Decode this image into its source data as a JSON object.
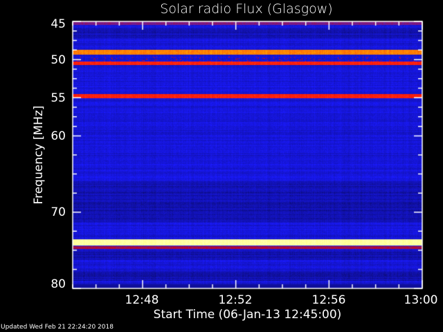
{
  "chart_data": {
    "type": "heatmap",
    "title": "Solar radio Flux (Glasgow)",
    "xlabel": "Start Time (06-Jan-13 12:45:00)",
    "ylabel": "Frequency [MHz]",
    "x_range": [
      "12:45",
      "13:00"
    ],
    "y_range": [
      45,
      80
    ],
    "y_inverted": true,
    "x_ticks": [
      "12:48",
      "12:52",
      "12:56",
      "13:00"
    ],
    "y_ticks": [
      "45",
      "50",
      "55",
      "60",
      "70",
      "80"
    ],
    "colormap": [
      "#000000",
      "#1010a0",
      "#1a1aff",
      "#6a20a0",
      "#d00000",
      "#ff2010",
      "#ffa000",
      "#ffff80",
      "#ffffe0"
    ],
    "bands": [
      {
        "freq": [
          45.0,
          45.4
        ],
        "intensity": 0.4
      },
      {
        "freq": [
          48.7,
          49.3
        ],
        "intensity": 0.72
      },
      {
        "freq": [
          50.2,
          50.7
        ],
        "intensity": 0.62
      },
      {
        "freq": [
          54.5,
          55.0
        ],
        "intensity": 0.62
      },
      {
        "freq": [
          73.5,
          74.3
        ],
        "intensity": 0.92
      },
      {
        "freq": [
          74.4,
          74.8
        ],
        "intensity": 0.45
      }
    ]
  },
  "footer": {
    "updated": "Updated Wed Feb 21 22:24:20 2018"
  }
}
